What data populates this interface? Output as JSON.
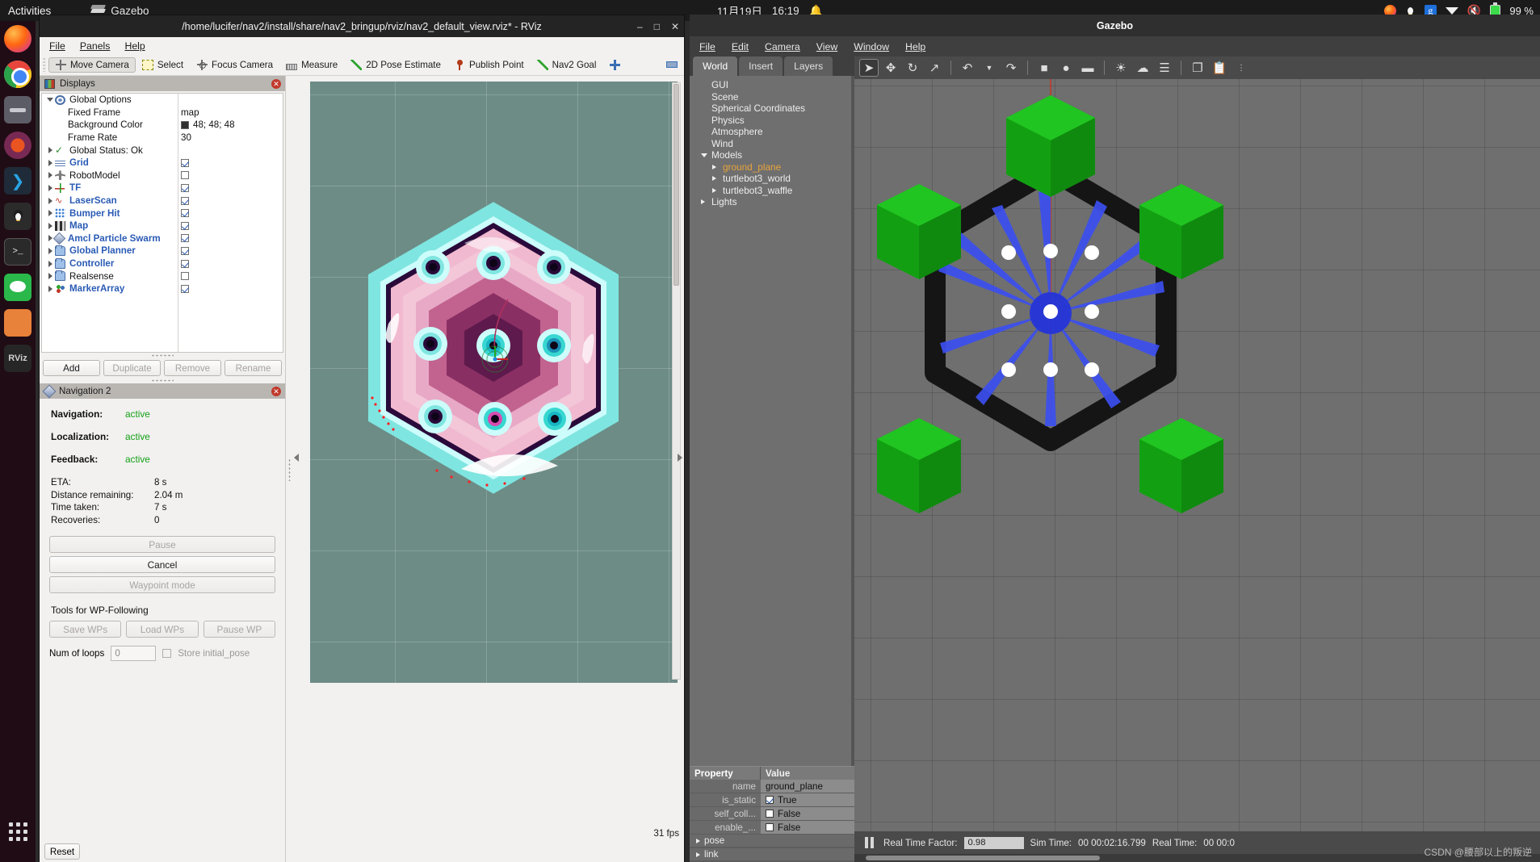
{
  "topbar": {
    "activities": "Activities",
    "app_name": "Gazebo",
    "app_icon": "gazebo-icon",
    "date": "11月19日",
    "time": "16:19",
    "bell_icon": "bell-icon",
    "battery_percent": "99 %",
    "tray_icons": [
      "firefox-icon",
      "tux-icon",
      "google-icon",
      "dropdown-icon",
      "volume-muted-icon",
      "battery-icon"
    ]
  },
  "dock": {
    "items": [
      {
        "name": "firefox",
        "label": ""
      },
      {
        "name": "chrome",
        "label": ""
      },
      {
        "name": "files",
        "label": ""
      },
      {
        "name": "ubuntu-software",
        "label": ""
      },
      {
        "name": "vscode",
        "label": "⌨"
      },
      {
        "name": "tux",
        "label": ""
      },
      {
        "name": "terminal",
        "label": ">_"
      },
      {
        "name": "wechat",
        "label": ""
      },
      {
        "name": "file-manager",
        "label": ""
      },
      {
        "name": "rviz",
        "label": "RViz"
      },
      {
        "name": "show-apps",
        "label": ""
      }
    ]
  },
  "rviz": {
    "title": "/home/lucifer/nav2/install/share/nav2_bringup/rviz/nav2_default_view.rviz* - RViz",
    "window_buttons": [
      "–",
      "□",
      "✕"
    ],
    "menu": [
      "File",
      "Panels",
      "Help"
    ],
    "toolbar": [
      {
        "label": "Move Camera",
        "icon": "move-camera-icon",
        "active": true
      },
      {
        "label": "Select",
        "icon": "select-icon",
        "active": false
      },
      {
        "label": "Focus Camera",
        "icon": "focus-camera-icon",
        "active": false
      },
      {
        "label": "Measure",
        "icon": "measure-icon",
        "active": false
      },
      {
        "label": "2D Pose Estimate",
        "icon": "pose-estimate-icon",
        "active": false
      },
      {
        "label": "Publish Point",
        "icon": "publish-point-icon",
        "active": false
      },
      {
        "label": "Nav2 Goal",
        "icon": "nav2-goal-icon",
        "active": false
      }
    ],
    "displays_panel": {
      "title": "Displays",
      "icon": "displays-icon",
      "close_icon": "close-icon",
      "rows": [
        {
          "label": "Global Options",
          "icon": "gear-icon",
          "arrow": "open",
          "indent": 0,
          "value": "",
          "bold": false,
          "kind": "group"
        },
        {
          "label": "Fixed Frame",
          "icon": "",
          "arrow": "",
          "indent": 1,
          "value": "map",
          "bold": false,
          "kind": "text"
        },
        {
          "label": "Background Color",
          "icon": "",
          "arrow": "",
          "indent": 1,
          "value": "48; 48; 48",
          "bold": false,
          "kind": "color"
        },
        {
          "label": "Frame Rate",
          "icon": "",
          "arrow": "",
          "indent": 1,
          "value": "30",
          "bold": false,
          "kind": "text"
        },
        {
          "label": "Global Status: Ok",
          "icon": "check-icon",
          "arrow": "closed",
          "indent": 0,
          "value": "",
          "bold": false,
          "kind": "status"
        },
        {
          "label": "Grid",
          "icon": "grid-icon",
          "arrow": "closed",
          "indent": 0,
          "value": "",
          "bold": true,
          "kind": "check",
          "checked": true
        },
        {
          "label": "RobotModel",
          "icon": "robot-icon",
          "arrow": "closed",
          "indent": 0,
          "value": "",
          "bold": false,
          "kind": "check",
          "checked": false
        },
        {
          "label": "TF",
          "icon": "tf-icon",
          "arrow": "closed",
          "indent": 0,
          "value": "",
          "bold": true,
          "kind": "check",
          "checked": true
        },
        {
          "label": "LaserScan",
          "icon": "laserscan-icon",
          "arrow": "closed",
          "indent": 0,
          "value": "",
          "bold": true,
          "kind": "check",
          "checked": true
        },
        {
          "label": "Bumper Hit",
          "icon": "bumper-icon",
          "arrow": "closed",
          "indent": 0,
          "value": "",
          "bold": true,
          "kind": "check",
          "checked": true
        },
        {
          "label": "Map",
          "icon": "map-icon",
          "arrow": "closed",
          "indent": 0,
          "value": "",
          "bold": true,
          "kind": "check",
          "checked": true
        },
        {
          "label": "Amcl Particle Swarm",
          "icon": "diamond-icon",
          "arrow": "closed",
          "indent": 0,
          "value": "",
          "bold": true,
          "kind": "check",
          "checked": true
        },
        {
          "label": "Global Planner",
          "icon": "folder-icon",
          "arrow": "closed",
          "indent": 0,
          "value": "",
          "bold": true,
          "kind": "check",
          "checked": true
        },
        {
          "label": "Controller",
          "icon": "folder-icon",
          "arrow": "closed",
          "indent": 0,
          "value": "",
          "bold": true,
          "kind": "check",
          "checked": true
        },
        {
          "label": "Realsense",
          "icon": "folder-icon",
          "arrow": "closed",
          "indent": 0,
          "value": "",
          "bold": false,
          "kind": "check",
          "checked": false
        },
        {
          "label": "MarkerArray",
          "icon": "markerarray-icon",
          "arrow": "closed",
          "indent": 0,
          "value": "",
          "bold": true,
          "kind": "check",
          "checked": true
        }
      ],
      "buttons": [
        {
          "label": "Add",
          "enabled": true
        },
        {
          "label": "Duplicate",
          "enabled": false
        },
        {
          "label": "Remove",
          "enabled": false
        },
        {
          "label": "Rename",
          "enabled": false
        }
      ]
    },
    "nav_panel": {
      "title": "Navigation 2",
      "icon": "nav2-icon",
      "close_icon": "close-icon",
      "status": [
        {
          "label": "Navigation:",
          "value": "active"
        },
        {
          "label": "Localization:",
          "value": "active"
        },
        {
          "label": "Feedback:",
          "value": "active"
        }
      ],
      "stats": [
        {
          "label": "ETA:",
          "value": "8 s"
        },
        {
          "label": "Distance remaining:",
          "value": "2.04 m"
        },
        {
          "label": "Time taken:",
          "value": "7 s"
        },
        {
          "label": "Recoveries:",
          "value": "0"
        }
      ],
      "buttons": [
        {
          "label": "Pause",
          "enabled": false
        },
        {
          "label": "Cancel",
          "enabled": true
        },
        {
          "label": "Waypoint mode",
          "enabled": false
        }
      ],
      "wp_section_label": "Tools for WP-Following",
      "wp_buttons": [
        {
          "label": "Save WPs",
          "enabled": false
        },
        {
          "label": "Load WPs",
          "enabled": false
        },
        {
          "label": "Pause WP",
          "enabled": false
        }
      ],
      "loops_label": "Num of loops",
      "loops_value": "0",
      "store_pose_label": "Store initial_pose",
      "store_pose_checked": false
    },
    "status_bar": {
      "fps": "31 fps",
      "reset_label": "Reset"
    }
  },
  "gazebo": {
    "title": "Gazebo",
    "menu": [
      "File",
      "Edit",
      "Camera",
      "View",
      "Window",
      "Help"
    ],
    "tabs": [
      {
        "label": "World",
        "active": true
      },
      {
        "label": "Insert",
        "active": false
      },
      {
        "label": "Layers",
        "active": false
      }
    ],
    "tree": [
      {
        "label": "GUI",
        "arrow": "",
        "indent": 0,
        "selected": false
      },
      {
        "label": "Scene",
        "arrow": "",
        "indent": 0,
        "selected": false
      },
      {
        "label": "Spherical Coordinates",
        "arrow": "",
        "indent": 0,
        "selected": false
      },
      {
        "label": "Physics",
        "arrow": "",
        "indent": 0,
        "selected": false
      },
      {
        "label": "Atmosphere",
        "arrow": "",
        "indent": 0,
        "selected": false
      },
      {
        "label": "Wind",
        "arrow": "",
        "indent": 0,
        "selected": false
      },
      {
        "label": "Models",
        "arrow": "open",
        "indent": 0,
        "selected": false
      },
      {
        "label": "ground_plane",
        "arrow": "closed",
        "indent": 1,
        "selected": true
      },
      {
        "label": "turtlebot3_world",
        "arrow": "closed",
        "indent": 1,
        "selected": false
      },
      {
        "label": "turtlebot3_waffle",
        "arrow": "closed",
        "indent": 1,
        "selected": false
      },
      {
        "label": "Lights",
        "arrow": "closed",
        "indent": 0,
        "selected": false
      }
    ],
    "property_headers": {
      "key": "Property",
      "value": "Value"
    },
    "properties": [
      {
        "key": "name",
        "value": "ground_plane",
        "kind": "text"
      },
      {
        "key": "is_static",
        "value": "True",
        "kind": "check",
        "checked": true
      },
      {
        "key": "self_coll...",
        "value": "False",
        "kind": "check",
        "checked": false
      },
      {
        "key": "enable_...",
        "value": "False",
        "kind": "check",
        "checked": false
      },
      {
        "key": "pose",
        "value": "",
        "kind": "group"
      },
      {
        "key": "link",
        "value": "",
        "kind": "group"
      }
    ],
    "toolbar_icons": [
      "cursor-icon",
      "translate-icon",
      "rotate-icon",
      "scale-icon",
      "undo-icon",
      "undo-dropdown-icon",
      "redo-icon",
      "box-icon",
      "sphere-icon",
      "cylinder-icon",
      "point-light-icon",
      "spot-light-icon",
      "directional-light-icon",
      "copy-icon",
      "paste-icon",
      "align-icon"
    ],
    "status": {
      "pause_icon": "pause-icon",
      "rtf_label": "Real Time Factor:",
      "rtf_value": "0.98",
      "sim_time_label": "Sim Time:",
      "sim_time_value": "00 00:02:16.799",
      "real_time_label": "Real Time:",
      "real_time_value": "00 00:0"
    }
  },
  "watermark": "CSDN @腰部以上的叛逆"
}
